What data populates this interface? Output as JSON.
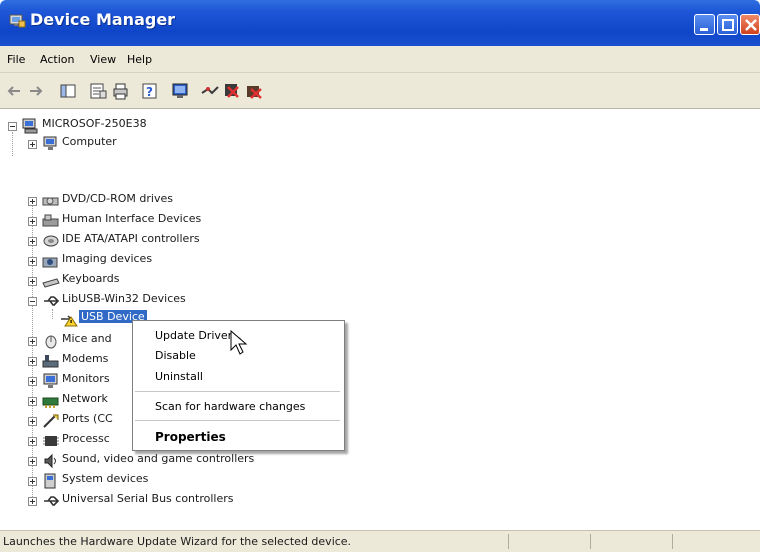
{
  "window": {
    "title": "Device Manager"
  },
  "menu": [
    "File",
    "Action",
    "View",
    "Help"
  ],
  "tree": {
    "root": "MICROSOF-250E38",
    "items": [
      {
        "label": "Computer",
        "icon": "computer-icon"
      },
      {
        "label": "DVD/CD-ROM drives",
        "icon": "dvd-drive-icon"
      },
      {
        "label": "Human Interface Devices",
        "icon": "hid-icon"
      },
      {
        "label": "IDE ATA/ATAPI controllers",
        "icon": "ide-controller-icon"
      },
      {
        "label": "Imaging devices",
        "icon": "imaging-device-icon"
      },
      {
        "label": "Keyboards",
        "icon": "keyboard-icon"
      },
      {
        "label": "LibUSB-Win32 Devices",
        "icon": "usb-icon"
      },
      {
        "label": "USB Device",
        "icon": "usb-device-warning-icon"
      },
      {
        "label": "Mice and",
        "icon": "mouse-icon"
      },
      {
        "label": "Modems",
        "icon": "modem-icon"
      },
      {
        "label": "Monitors",
        "icon": "monitor-icon"
      },
      {
        "label": "Network",
        "icon": "network-adapter-icon"
      },
      {
        "label": "Ports (CC",
        "icon": "port-icon"
      },
      {
        "label": "Processc",
        "icon": "processor-icon"
      },
      {
        "label": "Sound, video and game controllers",
        "icon": "sound-icon"
      },
      {
        "label": "System devices",
        "icon": "system-device-icon"
      },
      {
        "label": "Universal Serial Bus controllers",
        "icon": "usb-controller-icon"
      }
    ]
  },
  "context_menu": {
    "update_driver": "Update Driver...",
    "disable": "Disable",
    "uninstall": "Uninstall",
    "scan": "Scan for hardware changes",
    "properties": "Properties"
  },
  "status": {
    "text": "Launches the Hardware Update Wizard for the selected device."
  },
  "colors": {
    "titlebar": "#0f45c8",
    "selection": "#3169c6",
    "chrome": "#ece9d8"
  }
}
